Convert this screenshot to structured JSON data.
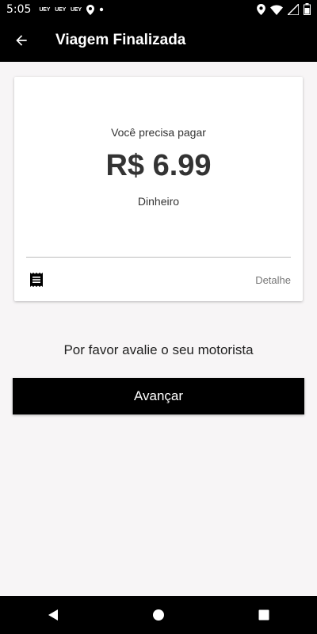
{
  "status_bar": {
    "time": "5:05",
    "badges": [
      "UEY",
      "UEY",
      "UEY"
    ],
    "icons": [
      "location-icon",
      "dot-icon",
      "location-icon",
      "wifi-icon",
      "signal-icon",
      "battery-icon"
    ]
  },
  "app_bar": {
    "back_icon": "arrow-left-icon",
    "title": "Viagem Finalizada"
  },
  "payment_card": {
    "label": "Você precisa pagar",
    "amount": "R$ 6.99",
    "method": "Dinheiro",
    "receipt_icon": "receipt-icon",
    "detail_label": "Detalhe"
  },
  "rating": {
    "prompt": "Por favor avalie o seu motorista"
  },
  "actions": {
    "next_label": "Avançar"
  },
  "nav_bar": {
    "icons": [
      "back-triangle-icon",
      "home-circle-icon",
      "recents-square-icon"
    ]
  }
}
